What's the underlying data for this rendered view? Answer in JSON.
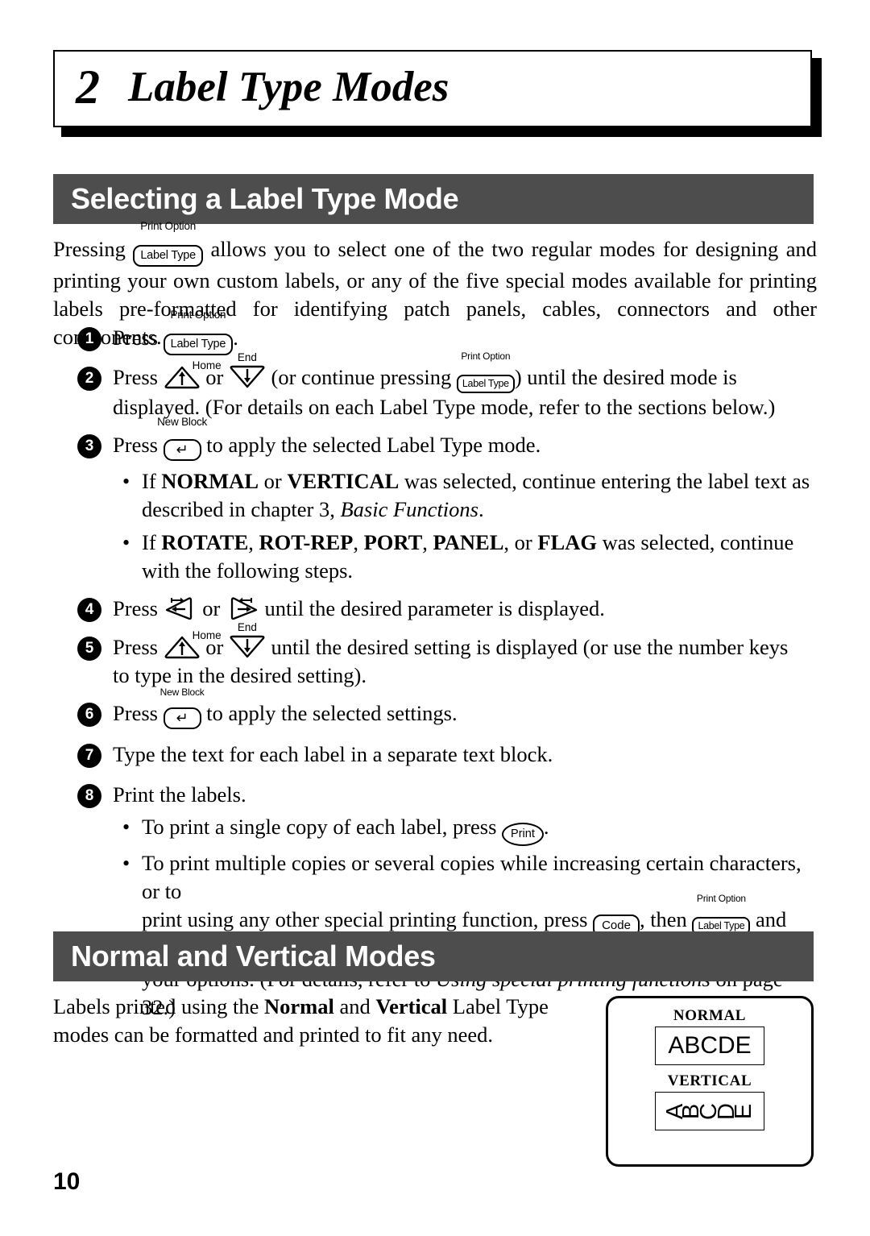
{
  "page": {
    "number": "10"
  },
  "chapter": {
    "number": "2",
    "title": "Label Type Modes"
  },
  "sections": [
    {
      "title": "Selecting a Label Type Mode"
    },
    {
      "title": "Normal and Vertical Modes"
    }
  ],
  "keys": {
    "label_type": "Label Type",
    "label_type_caption": "Print Option",
    "code": "Code",
    "print": "Print",
    "enter_glyph": "↵",
    "enter_caption": "New Block",
    "up_caption": "Home",
    "down_caption": "End"
  },
  "intro": {
    "p1_before": "Pressing",
    "p1_after": "allows you to select one of the two regular modes for designing and printing your own custom labels, or any of the five special modes available for printing labels pre-formatted for identifying patch panels, cables, connectors and other components."
  },
  "steps": [
    {
      "num": "1",
      "text_before": "Press",
      "text_after": "."
    },
    {
      "num": "2",
      "text_before": "Press",
      "text_mid_or": "or",
      "text_mid2": "(or continue pressing",
      "text_after": ") until the desired mode is",
      "cont": "displayed. (For details on each Label Type mode, refer to the sections below.)"
    },
    {
      "num": "3",
      "text_before": "Press",
      "text_after": "to apply the selected Label Type mode."
    },
    {
      "num": "4",
      "text_before": "Press",
      "text_mid_or": "or",
      "text_after": "until the desired parameter is displayed."
    },
    {
      "num": "5",
      "text_before": "Press",
      "text_mid_or": "or",
      "text_after": "until the desired setting is displayed (or use the number keys",
      "cont": "to type in the desired setting)."
    },
    {
      "num": "6",
      "text_before": "Press",
      "text_after": "to apply the selected settings."
    },
    {
      "num": "7",
      "text_before": "Type the text for each label in a separate text block."
    },
    {
      "num": "8",
      "text_before": "Print the labels."
    }
  ],
  "bullets": {
    "b1_p1": "If ",
    "b1_normal": "NORMAL",
    "b1_or": " or ",
    "b1_vertical": "VERTICAL",
    "b1_p2": " was selected, continue entering the label text as",
    "b1_cont_p1": "described in chapter 3, ",
    "b1_cont_ital": "Basic Functions",
    "b1_cont_p2": ".",
    "b2_p1": "If ",
    "b2_rotate": "ROTATE",
    "b2_c1": ", ",
    "b2_rotrep": "ROT-REP",
    "b2_c2": ", ",
    "b2_port": "PORT",
    "b2_c3": ", ",
    "b2_panel": "PANEL",
    "b2_c4": ", or ",
    "b2_flag": "FLAG",
    "b2_p2": " was selected, continue",
    "b2_cont": "with the following steps.",
    "b3_before": "To print a single copy of each label, press",
    "b3_after": ".",
    "b4_line1": "To print multiple copies or several copies while increasing certain characters, or to",
    "b4_line2_a": "print using any other special printing function, press",
    "b4_line2_b": ", then",
    "b4_line2_c": "and choose",
    "b4_line3_a": "your options. (For details, refer to ",
    "b4_line3_ital": "Using special printing functions",
    "b4_line3_b": " on page 32.)"
  },
  "normal_vertical": {
    "para_p1": "Labels printed using the ",
    "para_bold1": "Normal",
    "para_p2": " and ",
    "para_bold2": "Vertical",
    "para_p3": " Label Type modes can be formatted and printed to fit any need."
  },
  "illustration": {
    "normal_label": "NORMAL",
    "normal_sample": "ABCDE",
    "vertical_label": "VERTICAL",
    "vertical_sample": "ABCDE"
  },
  "colors": {
    "section_bar": "#4d4d4d",
    "text": "#000000",
    "background": "#ffffff"
  }
}
